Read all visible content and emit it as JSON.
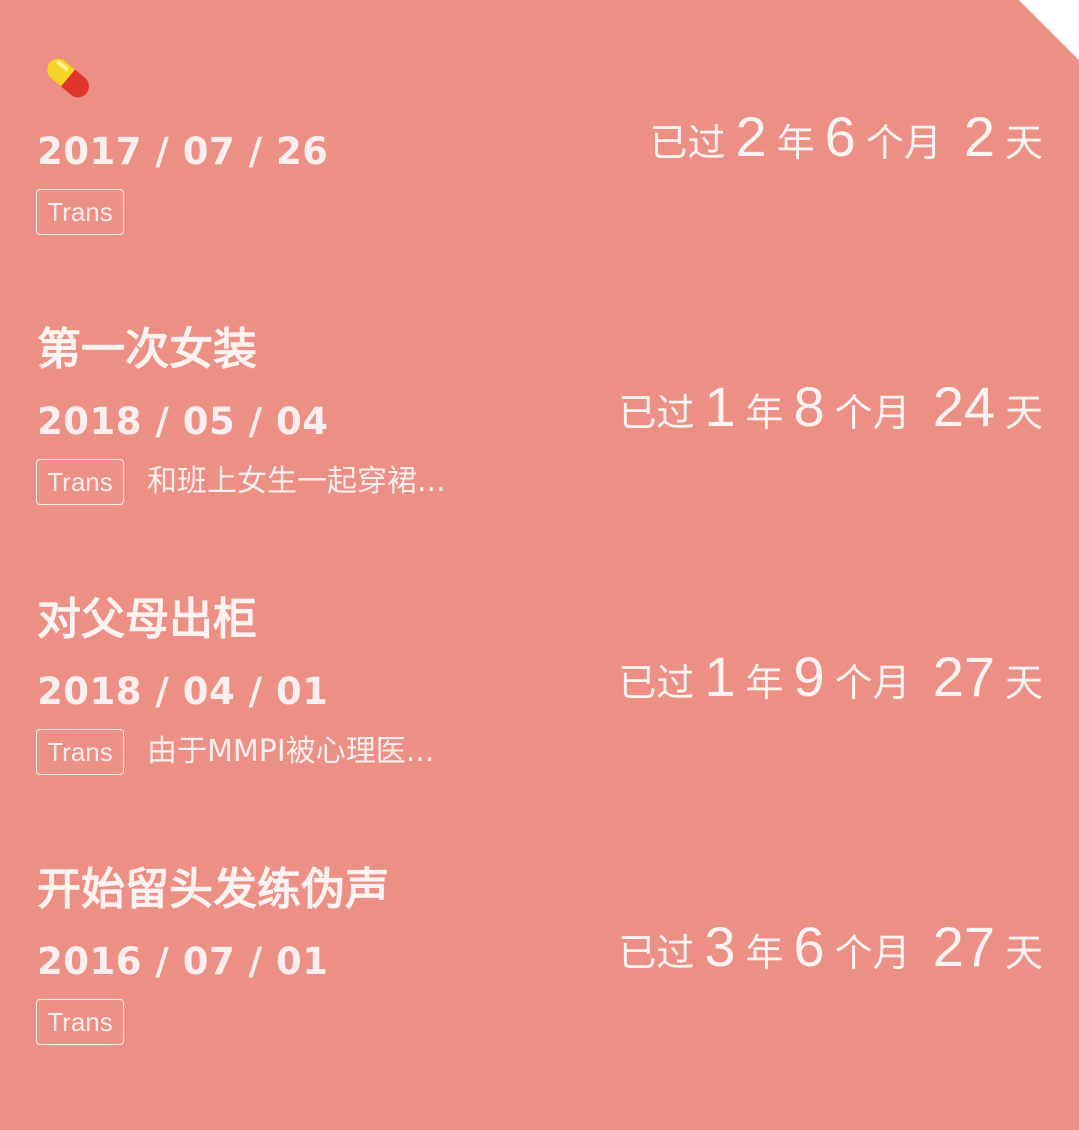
{
  "entries": [
    {
      "title": "",
      "icon": "pill-icon",
      "date": "2017 / 07 / 26",
      "tag": "Trans",
      "note": "",
      "elapsed": {
        "prefix": "已过",
        "years": "2",
        "year_unit": "年",
        "months": "6",
        "month_unit": "个月",
        "days": "2",
        "day_unit": "天"
      }
    },
    {
      "title": "第一次女装",
      "date": "2018 / 05 / 04",
      "tag": "Trans",
      "note": "和班上女生一起穿裙...",
      "elapsed": {
        "prefix": "已过",
        "years": "1",
        "year_unit": "年",
        "months": "8",
        "month_unit": "个月",
        "days": "24",
        "day_unit": "天"
      }
    },
    {
      "title": "对父母出柜",
      "date": "2018 / 04 / 01",
      "tag": "Trans",
      "note": "由于MMPI被心理医...",
      "elapsed": {
        "prefix": "已过",
        "years": "1",
        "year_unit": "年",
        "months": "9",
        "month_unit": "个月",
        "days": "27",
        "day_unit": "天"
      }
    },
    {
      "title": "开始留头发练伪声",
      "date": "2016 / 07 / 01",
      "tag": "Trans",
      "note": "",
      "elapsed": {
        "prefix": "已过",
        "years": "3",
        "year_unit": "年",
        "months": "6",
        "month_unit": "个月",
        "days": "27",
        "day_unit": "天"
      }
    }
  ],
  "colors": {
    "background": "#ec8f84",
    "text": "#fbeeee",
    "pill_yellow": "#f5d327",
    "pill_red": "#e0352b"
  }
}
